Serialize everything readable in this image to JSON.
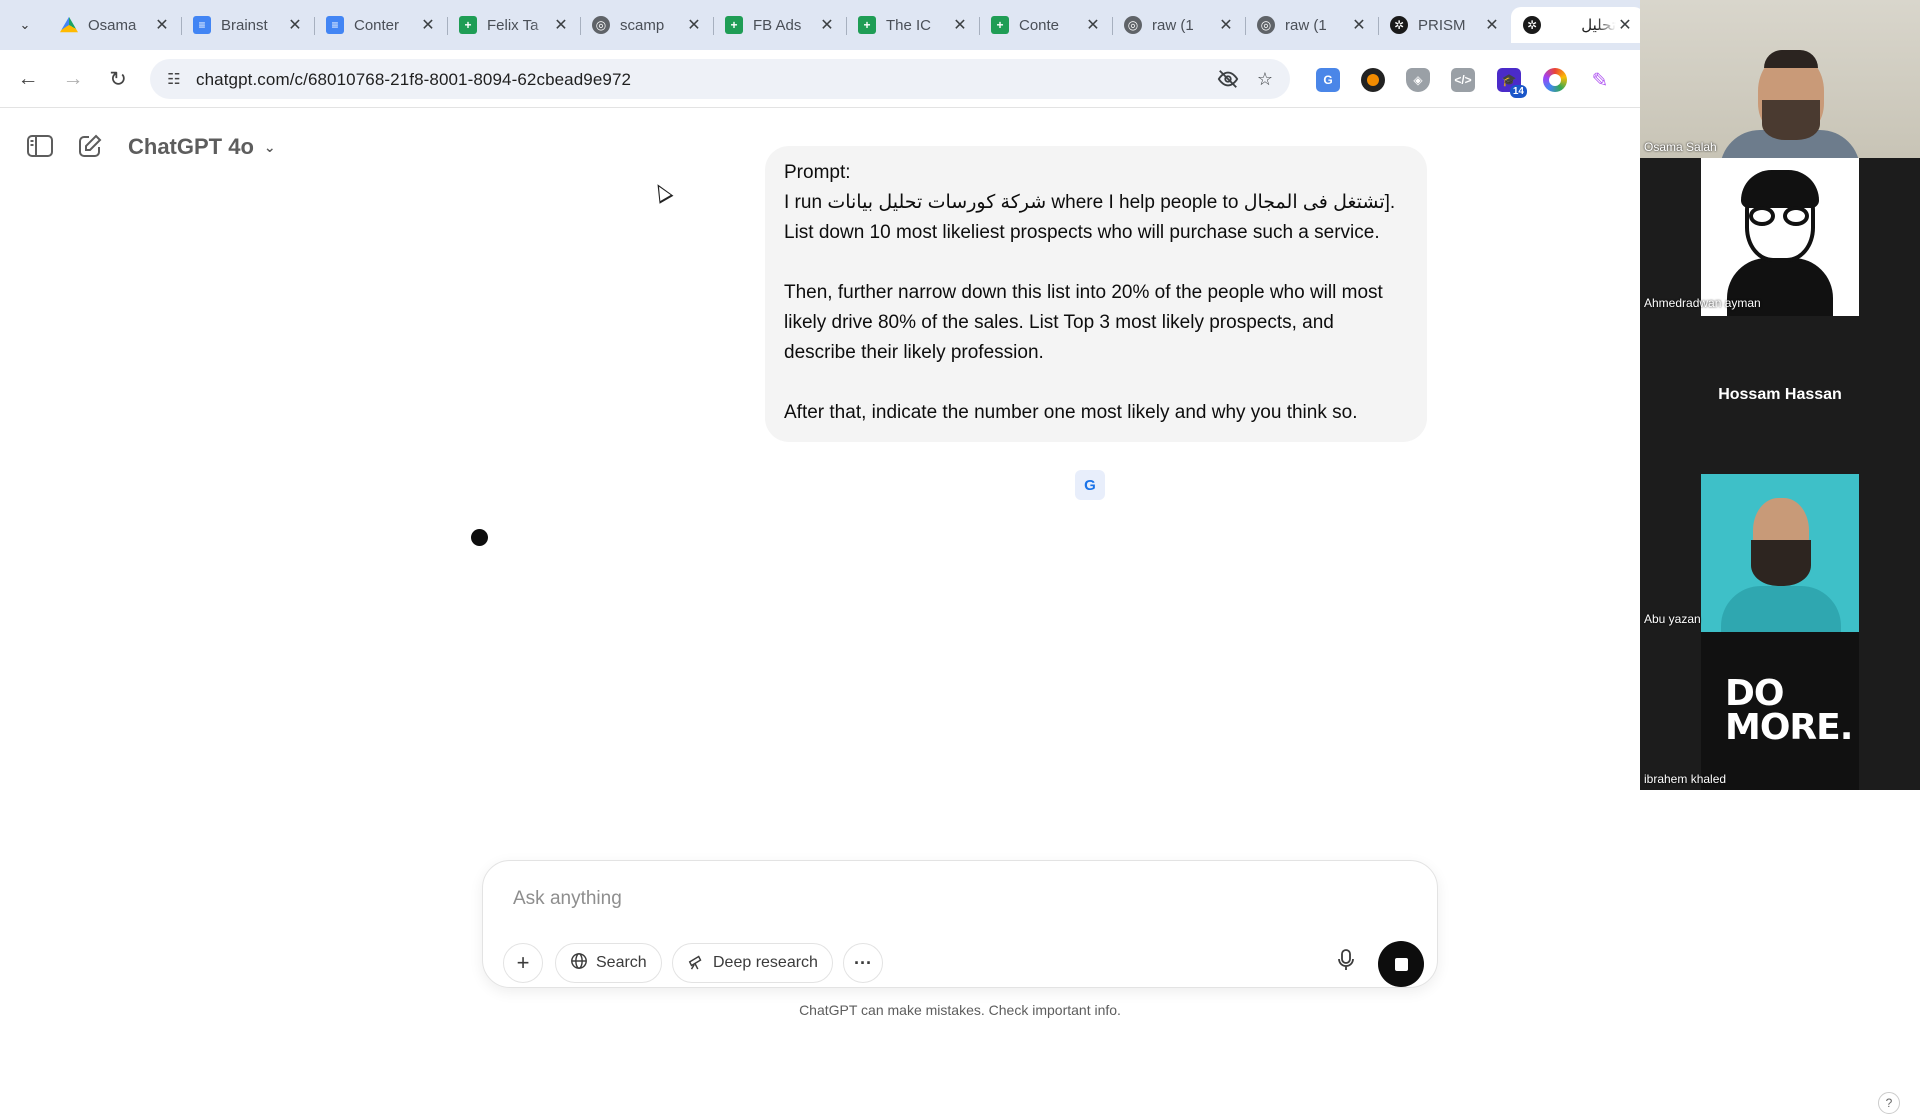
{
  "tabs": [
    {
      "title": "Osama",
      "favicon": "drive-icon"
    },
    {
      "title": "Brainst",
      "favicon": "docs-icon"
    },
    {
      "title": "Conter",
      "favicon": "docs-icon"
    },
    {
      "title": "Felix Ta",
      "favicon": "sheets-icon"
    },
    {
      "title": "scamp",
      "favicon": "globe-icon"
    },
    {
      "title": "FB Ads",
      "favicon": "sheets-icon"
    },
    {
      "title": "The IC",
      "favicon": "sheets-icon"
    },
    {
      "title": "Conte",
      "favicon": "sheets-icon"
    },
    {
      "title": "raw (1",
      "favicon": "globe-icon"
    },
    {
      "title": "raw (1",
      "favicon": "globe-icon"
    },
    {
      "title": "PRISM",
      "favicon": "chatgpt-icon"
    },
    {
      "title": "تحليل",
      "favicon": "chatgpt-icon",
      "active": true
    }
  ],
  "address_bar": {
    "url": "chatgpt.com/c/68010768-21f8-8001-8094-62cbead9e972"
  },
  "extensions": {
    "badge_count": "14"
  },
  "chat": {
    "model_name": "ChatGPT 4o",
    "user_message": {
      "label": "Prompt:",
      "line1_a": "I run ",
      "line1_ar": "شركة كورسات تحليل بيانات",
      "line1_b": " where I help people to ",
      "line1_ar2": "تشتغل فى المجال",
      "line1_c": "]. List down 10 most likeliest prospects who will purchase such a service.",
      "paragraph2": "Then, further narrow down this list into 20% of the people who will most likely drive 80% of the sales. List Top 3 most likely prospects, and describe their likely profession.",
      "paragraph3": "After that, indicate the number one most likely and why you think so."
    }
  },
  "composer": {
    "placeholder": "Ask anything",
    "search_label": "Search",
    "deep_research_label": "Deep research"
  },
  "disclaimer": "ChatGPT can make mistakes. Check important info.",
  "help_label": "?",
  "meeting": {
    "participants": [
      {
        "name": "Osama Salah"
      },
      {
        "name": "Ahmedradwan ayman"
      },
      {
        "name": "Hossam Hassan"
      },
      {
        "name": "Abu yazan"
      },
      {
        "name": "ibrahem khaled"
      }
    ],
    "domore_text": "DO MORE."
  }
}
